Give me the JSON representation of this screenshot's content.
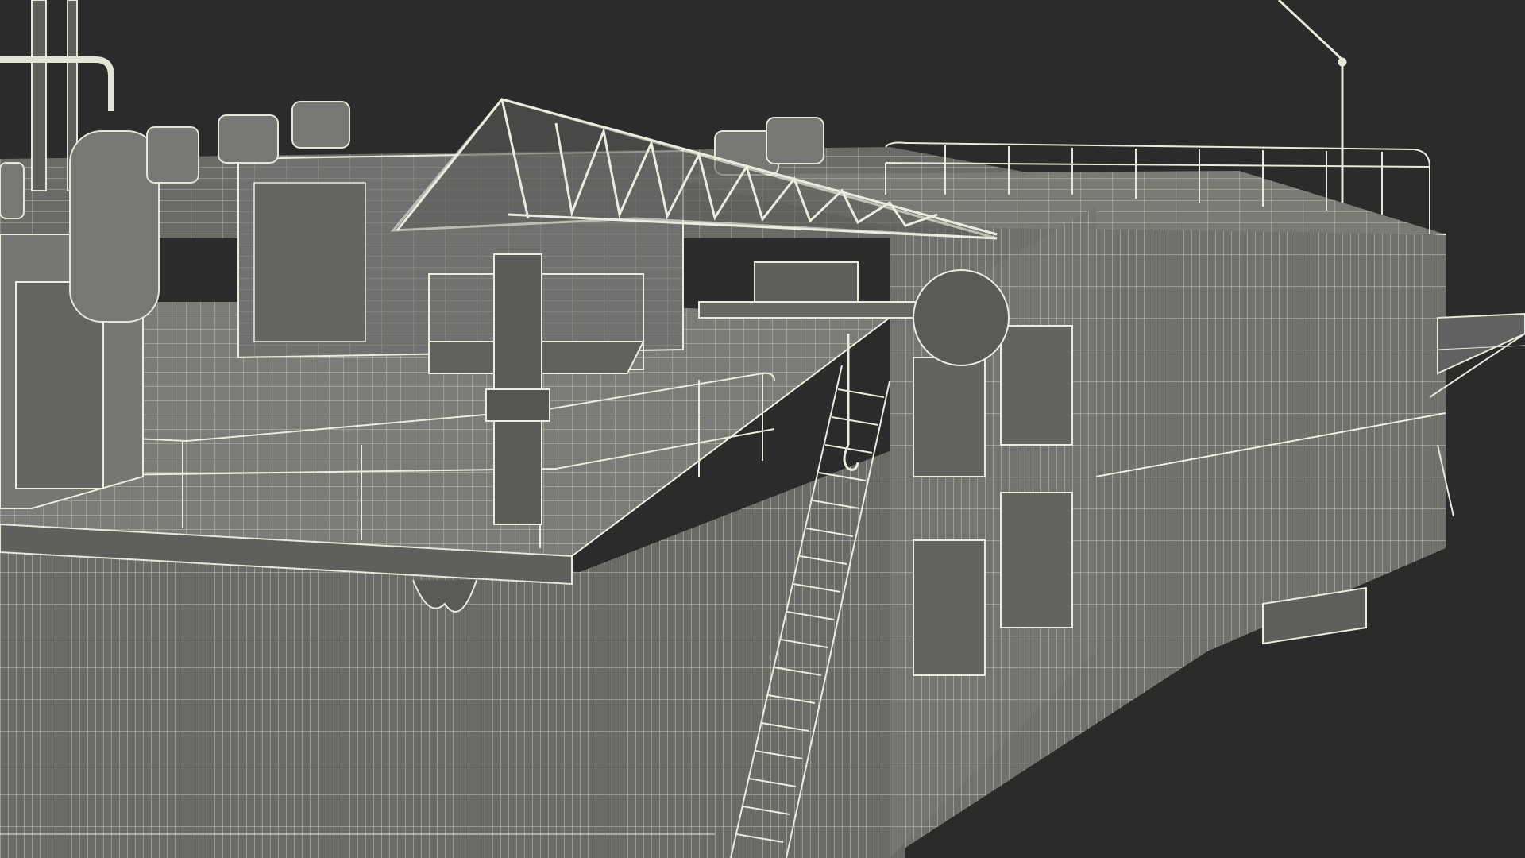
{
  "viewport": {
    "background": "#2b2b2b",
    "render_style": "wireframe-on-shaded",
    "wire_color": "#e6e6d8",
    "surface_color": "#6e6f6a"
  },
  "scene": {
    "subject": "floating-dock-barge-with-crane",
    "visible_parts": [
      "hull",
      "main-deck",
      "jib-crane",
      "crane-platform",
      "service-ladder",
      "deck-railings",
      "storage-tanks",
      "exhaust-stack",
      "deckhouse-blocks",
      "side-walkway",
      "antenna-mast"
    ]
  }
}
